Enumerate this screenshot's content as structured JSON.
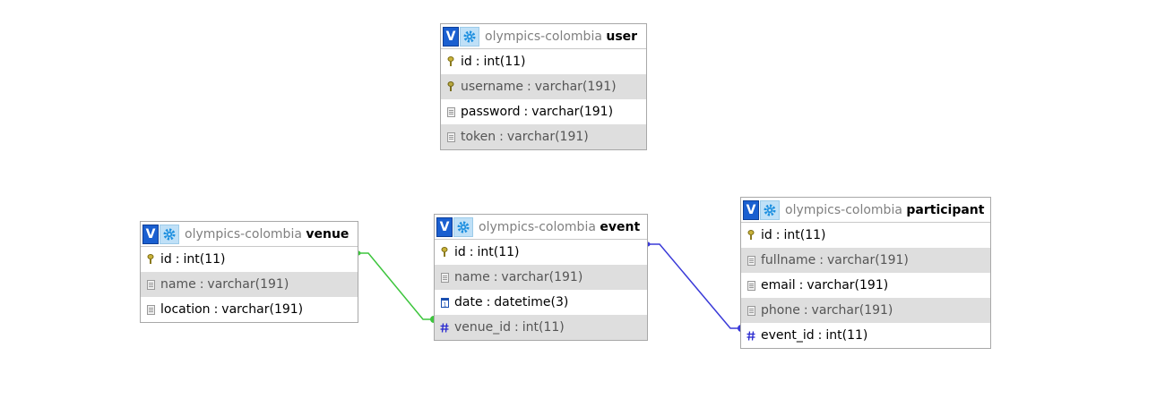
{
  "colors": {
    "venue_event_link": "#3dc53d",
    "event_participant_link": "#3a3ad8",
    "v_button": "#1a5fd0",
    "row_alt": "#dedede"
  },
  "tables": {
    "user": {
      "schema": "olympics-colombia",
      "name": "user",
      "columns": [
        {
          "name": "id",
          "type": "int(11)",
          "icon": "primary-key-icon"
        },
        {
          "name": "username",
          "type": "varchar(191)",
          "icon": "unique-key-icon"
        },
        {
          "name": "password",
          "type": "varchar(191)",
          "icon": "text-column-icon"
        },
        {
          "name": "token",
          "type": "varchar(191)",
          "icon": "text-column-icon"
        }
      ]
    },
    "venue": {
      "schema": "olympics-colombia",
      "name": "venue",
      "columns": [
        {
          "name": "id",
          "type": "int(11)",
          "icon": "primary-key-icon"
        },
        {
          "name": "name",
          "type": "varchar(191)",
          "icon": "text-column-icon"
        },
        {
          "name": "location",
          "type": "varchar(191)",
          "icon": "text-column-icon"
        }
      ]
    },
    "event": {
      "schema": "olympics-colombia",
      "name": "event",
      "columns": [
        {
          "name": "id",
          "type": "int(11)",
          "icon": "primary-key-icon"
        },
        {
          "name": "name",
          "type": "varchar(191)",
          "icon": "text-column-icon"
        },
        {
          "name": "date",
          "type": "datetime(3)",
          "icon": "calendar-icon"
        },
        {
          "name": "venue_id",
          "type": "int(11)",
          "icon": "hash-icon"
        }
      ]
    },
    "participant": {
      "schema": "olympics-colombia",
      "name": "participant",
      "columns": [
        {
          "name": "id",
          "type": "int(11)",
          "icon": "primary-key-icon"
        },
        {
          "name": "fullname",
          "type": "varchar(191)",
          "icon": "text-column-icon"
        },
        {
          "name": "email",
          "type": "varchar(191)",
          "icon": "text-column-icon"
        },
        {
          "name": "phone",
          "type": "varchar(191)",
          "icon": "text-column-icon"
        },
        {
          "name": "event_id",
          "type": "int(11)",
          "icon": "hash-icon"
        }
      ]
    }
  },
  "relations": [
    {
      "from": "venue.id",
      "to": "event.venue_id"
    },
    {
      "from": "event.id",
      "to": "participant.event_id"
    }
  ],
  "buttons": {
    "v_label": "V"
  },
  "separator": ":"
}
